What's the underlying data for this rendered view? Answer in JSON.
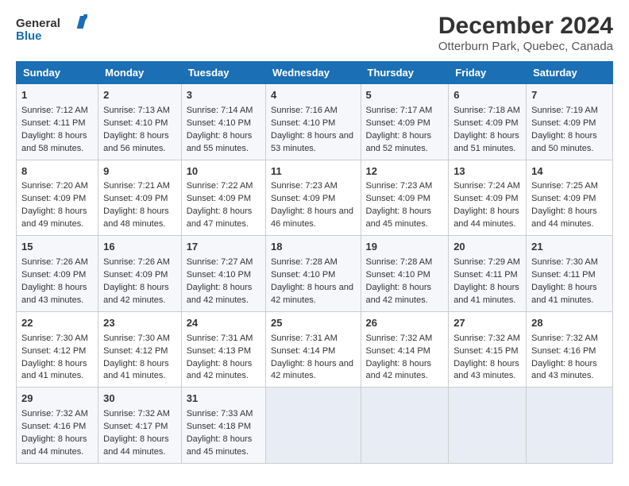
{
  "logo": {
    "line1": "General",
    "line2": "Blue"
  },
  "title": "December 2024",
  "subtitle": "Otterburn Park, Quebec, Canada",
  "days_of_week": [
    "Sunday",
    "Monday",
    "Tuesday",
    "Wednesday",
    "Thursday",
    "Friday",
    "Saturday"
  ],
  "weeks": [
    [
      {
        "day": "1",
        "sunrise": "Sunrise: 7:12 AM",
        "sunset": "Sunset: 4:11 PM",
        "daylight": "Daylight: 8 hours and 58 minutes."
      },
      {
        "day": "2",
        "sunrise": "Sunrise: 7:13 AM",
        "sunset": "Sunset: 4:10 PM",
        "daylight": "Daylight: 8 hours and 56 minutes."
      },
      {
        "day": "3",
        "sunrise": "Sunrise: 7:14 AM",
        "sunset": "Sunset: 4:10 PM",
        "daylight": "Daylight: 8 hours and 55 minutes."
      },
      {
        "day": "4",
        "sunrise": "Sunrise: 7:16 AM",
        "sunset": "Sunset: 4:10 PM",
        "daylight": "Daylight: 8 hours and 53 minutes."
      },
      {
        "day": "5",
        "sunrise": "Sunrise: 7:17 AM",
        "sunset": "Sunset: 4:09 PM",
        "daylight": "Daylight: 8 hours and 52 minutes."
      },
      {
        "day": "6",
        "sunrise": "Sunrise: 7:18 AM",
        "sunset": "Sunset: 4:09 PM",
        "daylight": "Daylight: 8 hours and 51 minutes."
      },
      {
        "day": "7",
        "sunrise": "Sunrise: 7:19 AM",
        "sunset": "Sunset: 4:09 PM",
        "daylight": "Daylight: 8 hours and 50 minutes."
      }
    ],
    [
      {
        "day": "8",
        "sunrise": "Sunrise: 7:20 AM",
        "sunset": "Sunset: 4:09 PM",
        "daylight": "Daylight: 8 hours and 49 minutes."
      },
      {
        "day": "9",
        "sunrise": "Sunrise: 7:21 AM",
        "sunset": "Sunset: 4:09 PM",
        "daylight": "Daylight: 8 hours and 48 minutes."
      },
      {
        "day": "10",
        "sunrise": "Sunrise: 7:22 AM",
        "sunset": "Sunset: 4:09 PM",
        "daylight": "Daylight: 8 hours and 47 minutes."
      },
      {
        "day": "11",
        "sunrise": "Sunrise: 7:23 AM",
        "sunset": "Sunset: 4:09 PM",
        "daylight": "Daylight: 8 hours and 46 minutes."
      },
      {
        "day": "12",
        "sunrise": "Sunrise: 7:23 AM",
        "sunset": "Sunset: 4:09 PM",
        "daylight": "Daylight: 8 hours and 45 minutes."
      },
      {
        "day": "13",
        "sunrise": "Sunrise: 7:24 AM",
        "sunset": "Sunset: 4:09 PM",
        "daylight": "Daylight: 8 hours and 44 minutes."
      },
      {
        "day": "14",
        "sunrise": "Sunrise: 7:25 AM",
        "sunset": "Sunset: 4:09 PM",
        "daylight": "Daylight: 8 hours and 44 minutes."
      }
    ],
    [
      {
        "day": "15",
        "sunrise": "Sunrise: 7:26 AM",
        "sunset": "Sunset: 4:09 PM",
        "daylight": "Daylight: 8 hours and 43 minutes."
      },
      {
        "day": "16",
        "sunrise": "Sunrise: 7:26 AM",
        "sunset": "Sunset: 4:09 PM",
        "daylight": "Daylight: 8 hours and 42 minutes."
      },
      {
        "day": "17",
        "sunrise": "Sunrise: 7:27 AM",
        "sunset": "Sunset: 4:10 PM",
        "daylight": "Daylight: 8 hours and 42 minutes."
      },
      {
        "day": "18",
        "sunrise": "Sunrise: 7:28 AM",
        "sunset": "Sunset: 4:10 PM",
        "daylight": "Daylight: 8 hours and 42 minutes."
      },
      {
        "day": "19",
        "sunrise": "Sunrise: 7:28 AM",
        "sunset": "Sunset: 4:10 PM",
        "daylight": "Daylight: 8 hours and 42 minutes."
      },
      {
        "day": "20",
        "sunrise": "Sunrise: 7:29 AM",
        "sunset": "Sunset: 4:11 PM",
        "daylight": "Daylight: 8 hours and 41 minutes."
      },
      {
        "day": "21",
        "sunrise": "Sunrise: 7:30 AM",
        "sunset": "Sunset: 4:11 PM",
        "daylight": "Daylight: 8 hours and 41 minutes."
      }
    ],
    [
      {
        "day": "22",
        "sunrise": "Sunrise: 7:30 AM",
        "sunset": "Sunset: 4:12 PM",
        "daylight": "Daylight: 8 hours and 41 minutes."
      },
      {
        "day": "23",
        "sunrise": "Sunrise: 7:30 AM",
        "sunset": "Sunset: 4:12 PM",
        "daylight": "Daylight: 8 hours and 41 minutes."
      },
      {
        "day": "24",
        "sunrise": "Sunrise: 7:31 AM",
        "sunset": "Sunset: 4:13 PM",
        "daylight": "Daylight: 8 hours and 42 minutes."
      },
      {
        "day": "25",
        "sunrise": "Sunrise: 7:31 AM",
        "sunset": "Sunset: 4:14 PM",
        "daylight": "Daylight: 8 hours and 42 minutes."
      },
      {
        "day": "26",
        "sunrise": "Sunrise: 7:32 AM",
        "sunset": "Sunset: 4:14 PM",
        "daylight": "Daylight: 8 hours and 42 minutes."
      },
      {
        "day": "27",
        "sunrise": "Sunrise: 7:32 AM",
        "sunset": "Sunset: 4:15 PM",
        "daylight": "Daylight: 8 hours and 43 minutes."
      },
      {
        "day": "28",
        "sunrise": "Sunrise: 7:32 AM",
        "sunset": "Sunset: 4:16 PM",
        "daylight": "Daylight: 8 hours and 43 minutes."
      }
    ],
    [
      {
        "day": "29",
        "sunrise": "Sunrise: 7:32 AM",
        "sunset": "Sunset: 4:16 PM",
        "daylight": "Daylight: 8 hours and 44 minutes."
      },
      {
        "day": "30",
        "sunrise": "Sunrise: 7:32 AM",
        "sunset": "Sunset: 4:17 PM",
        "daylight": "Daylight: 8 hours and 44 minutes."
      },
      {
        "day": "31",
        "sunrise": "Sunrise: 7:33 AM",
        "sunset": "Sunset: 4:18 PM",
        "daylight": "Daylight: 8 hours and 45 minutes."
      },
      null,
      null,
      null,
      null
    ]
  ]
}
